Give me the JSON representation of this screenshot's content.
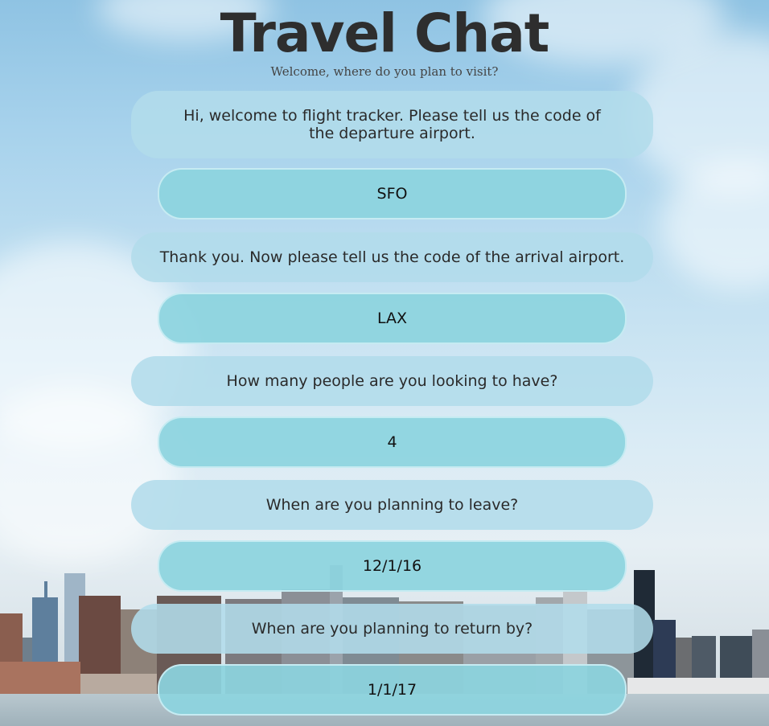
{
  "header": {
    "title": "Travel Chat",
    "subtitle": "Welcome, where do you plan to visit?"
  },
  "messages": [
    {
      "role": "bot",
      "text": "Hi, welcome to flight tracker. Please tell us the code of the departure airport."
    },
    {
      "role": "user",
      "text": "SFO"
    },
    {
      "role": "bot",
      "text": "Thank you. Now please tell us the code of the arrival airport."
    },
    {
      "role": "user",
      "text": "LAX"
    },
    {
      "role": "bot",
      "text": "How many people are you looking to have?"
    },
    {
      "role": "user",
      "text": "4"
    },
    {
      "role": "bot",
      "text": "When are you planning to leave?"
    },
    {
      "role": "user",
      "text": "12/1/16"
    },
    {
      "role": "bot",
      "text": "When are you planning to return by?"
    },
    {
      "role": "user",
      "text": "1/1/17"
    }
  ],
  "colors": {
    "bot_bubble": "#b2dcea",
    "user_bubble": "#8cd4de",
    "title": "#2e2e2e"
  }
}
